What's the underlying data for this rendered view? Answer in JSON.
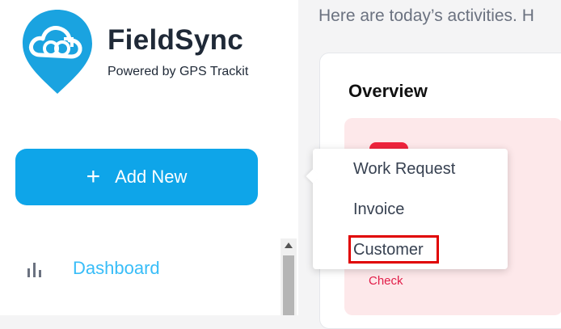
{
  "brand": {
    "name": "FieldSync",
    "tagline": "Powered by GPS Trackit",
    "logo_icon": "cloud-sync-pin-icon",
    "accent_color": "#1aa3e0"
  },
  "sidebar": {
    "add_button_label": "Add New",
    "add_icon": "plus-icon",
    "items": [
      {
        "label": "Dashboard",
        "icon": "bar-chart-icon"
      }
    ]
  },
  "main": {
    "greeting": "Here are today’s activities. H",
    "overview_title": "Overview",
    "tile_link": "Check"
  },
  "dropdown": {
    "items": [
      "Work Request",
      "Invoice",
      "Customer"
    ],
    "highlighted": "Customer"
  }
}
